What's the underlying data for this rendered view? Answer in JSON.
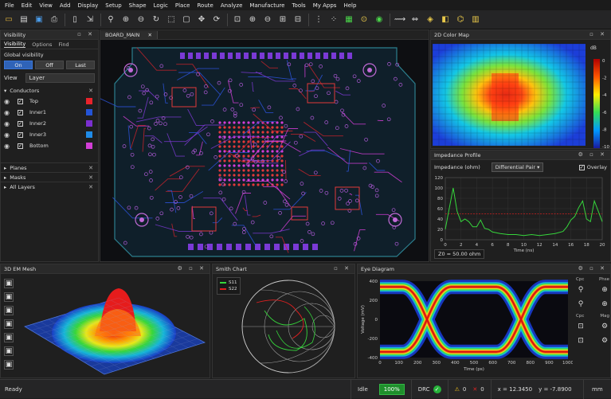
{
  "menu": [
    "File",
    "Edit",
    "View",
    "Add",
    "Display",
    "Setup",
    "Shape",
    "Logic",
    "Place",
    "Route",
    "Analyze",
    "Manufacture",
    "Tools",
    "My Apps",
    "Help"
  ],
  "toolbar_icons": [
    "folder-icon",
    "open-icon",
    "save-icon",
    "print-icon",
    "document-icon",
    "export-icon",
    "zoom-icon",
    "zoom-in-icon",
    "zoom-out-icon",
    "refresh-icon",
    "select-box-icon",
    "select-area-icon",
    "move-icon",
    "rotate-icon",
    "zoom-fit-icon",
    "zoom-in-icon",
    "zoom-out-icon",
    "zoom-area-icon",
    "zoom-prev-icon",
    "grid-icon",
    "snap-icon",
    "component-icon",
    "pin-icon",
    "via-icon",
    "route-icon",
    "measure-icon",
    "drc-icon",
    "layer-icon",
    "net-icon",
    "display-icon"
  ],
  "visibility": {
    "title": "Visibility",
    "tabs": [
      "Visibility",
      "Options",
      "Find"
    ],
    "global_label": "Global visibility",
    "buttons": [
      "On",
      "Off",
      "Last"
    ],
    "view_label": "View",
    "view_value": "Layer",
    "conductors_label": "Conductors",
    "layers": [
      {
        "name": "Top",
        "color": "#e8232b"
      },
      {
        "name": "Inner1",
        "color": "#2454d6"
      },
      {
        "name": "Inner2",
        "color": "#7b2fd0"
      },
      {
        "name": "Inner3",
        "color": "#1f8be8"
      },
      {
        "name": "Bottom",
        "color": "#d23ed6"
      }
    ],
    "sections": [
      "Planes",
      "Masks",
      "All Layers"
    ]
  },
  "board_tab": "BOARD_MAIN",
  "colormap": {
    "title": "2D Color Map",
    "unit": "dB",
    "ticks": [
      "0",
      "-2",
      "-4",
      "-6",
      "-8",
      "-10"
    ]
  },
  "impedance": {
    "title": "Impedance Profile",
    "label": "Impedance (ohm)",
    "mode": "Differential Pair",
    "overlay_label": "Overlay",
    "z0": "Z0 = 50.00 ohm",
    "chart_data": {
      "type": "line",
      "xlabel": "Time (ns)",
      "ylabel": "",
      "xlim": [
        0,
        20
      ],
      "ylim": [
        0,
        120
      ],
      "x_ticks": [
        0,
        2,
        4,
        6,
        8,
        10,
        12,
        14,
        16,
        18,
        20
      ],
      "y_ticks": [
        0,
        20,
        40,
        60,
        80,
        100,
        120
      ],
      "reference": 50,
      "series": [
        {
          "x": [
            0,
            0.5,
            1,
            1.5,
            2,
            2.5,
            3,
            3.5,
            4,
            4.5,
            5,
            5.5,
            6,
            7,
            8,
            9,
            10,
            11,
            12,
            13,
            14,
            15,
            15.5,
            16,
            16.5,
            17,
            17.5,
            18,
            18.5,
            19,
            19.5,
            20
          ],
          "y": [
            20,
            60,
            100,
            55,
            35,
            40,
            35,
            25,
            25,
            38,
            22,
            20,
            15,
            12,
            10,
            10,
            8,
            10,
            8,
            10,
            12,
            16,
            25,
            38,
            45,
            62,
            75,
            40,
            35,
            75,
            55,
            35
          ]
        }
      ]
    }
  },
  "mesh": {
    "title": "3D EM Mesh",
    "side_icons": [
      "layers-icon",
      "mesh-icon",
      "surface-icon",
      "wire-icon",
      "target-icon",
      "field-icon",
      "settings-icon"
    ]
  },
  "smith": {
    "title": "Smith Chart",
    "legend": [
      {
        "name": "S11",
        "color": "#36d63c"
      },
      {
        "name": "S22",
        "color": "#e02020"
      }
    ]
  },
  "eye": {
    "title": "Eye Diagram",
    "chart_data": {
      "type": "heatmap",
      "xlabel": "Time (ps)",
      "ylabel": "Voltage (mV)",
      "xlim": [
        0,
        1000
      ],
      "ylim": [
        -400,
        400
      ],
      "x_ticks": [
        0,
        100,
        200,
        300,
        400,
        500,
        600,
        700,
        800,
        900,
        1000
      ],
      "y_ticks": [
        -400,
        -200,
        0,
        200,
        400
      ]
    },
    "side_labels": [
      "Cpc",
      "Phse",
      "Cpc",
      "Mag"
    ]
  },
  "status": {
    "ready": "Ready",
    "idle": "Idle",
    "progress": "100%",
    "drc": "DRC",
    "warnings": "0",
    "errors": "0",
    "x": "x = 12.3450",
    "y": "y = -7.8900",
    "units": "mm"
  }
}
